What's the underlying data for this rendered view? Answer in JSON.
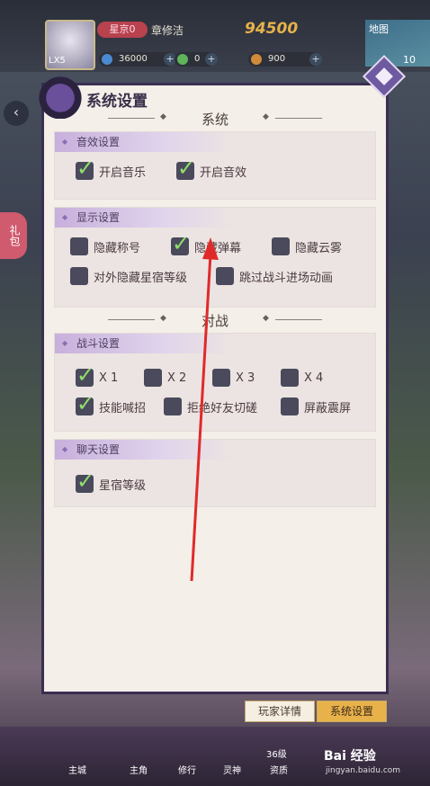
{
  "topbar": {
    "vip": "星京0",
    "player_name": "章修洁",
    "power": "94500",
    "level": "LX5",
    "resources": [
      {
        "value": "36000",
        "color": "#4a8ad0"
      },
      {
        "value": "0",
        "color": "#5fb35a"
      },
      {
        "value": "900",
        "color": "#d08a3a"
      }
    ],
    "map_label": "地图",
    "map_level": "10"
  },
  "side": {
    "gift": "礼包"
  },
  "panel": {
    "title": "系统设置",
    "section_system": "系统",
    "section_battle": "对战",
    "audio": {
      "title": "音效设置",
      "options": [
        {
          "label": "开启音乐",
          "checked": true
        },
        {
          "label": "开启音效",
          "checked": true
        }
      ]
    },
    "display": {
      "title": "显示设置",
      "options": [
        {
          "label": "隐藏称号",
          "checked": false
        },
        {
          "label": "隐藏弹幕",
          "checked": true
        },
        {
          "label": "隐藏云雾",
          "checked": false
        },
        {
          "label": "对外隐藏星宿等级",
          "checked": false
        },
        {
          "label": "跳过战斗进场动画",
          "checked": false
        }
      ]
    },
    "combat": {
      "title": "战斗设置",
      "options": [
        {
          "label": "X 1",
          "checked": true
        },
        {
          "label": "X 2",
          "checked": false
        },
        {
          "label": "X 3",
          "checked": false
        },
        {
          "label": "X 4",
          "checked": false
        },
        {
          "label": "技能喊招",
          "checked": true
        },
        {
          "label": "拒绝好友切磋",
          "checked": false
        },
        {
          "label": "屏蔽震屏",
          "checked": false
        }
      ]
    },
    "chat": {
      "title": "聊天设置",
      "options": [
        {
          "label": "星宿等级",
          "checked": true
        }
      ]
    }
  },
  "tabs": {
    "player_detail": "玩家详情",
    "system_settings": "系统设置"
  },
  "nav": {
    "items": [
      "主城",
      "主角",
      "修行",
      "灵神",
      "36级",
      "资质"
    ]
  },
  "watermark": {
    "main": "Bai 经验",
    "sub": "jingyan.baidu.com"
  },
  "colors": {
    "accent": "#6e5aa0",
    "check": "#8fe06a",
    "arrow": "#e02a2a"
  }
}
